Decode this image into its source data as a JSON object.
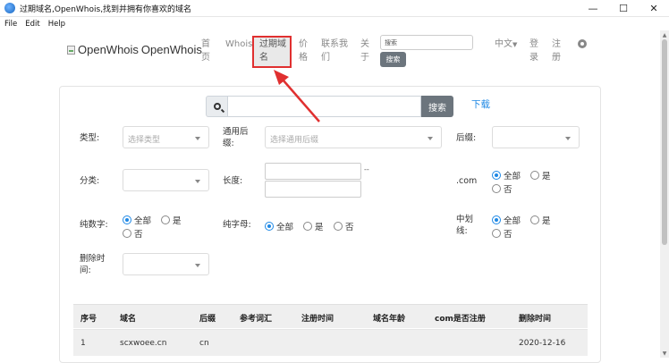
{
  "window": {
    "title": "过期域名,OpenWhois,找到并拥有你喜欢的域名",
    "minimize": "—",
    "maximize": "☐",
    "close": "✕"
  },
  "menu": [
    "File",
    "Edit",
    "Help"
  ],
  "nav": {
    "logo_alt": "OpenWhois",
    "logo_text": "OpenWhois",
    "items": [
      {
        "label_1": "首",
        "label_2": "页"
      },
      {
        "label_1": "Whois",
        "label_2": ""
      },
      {
        "label_1": "过期域",
        "label_2": "名"
      },
      {
        "label_1": "价",
        "label_2": "格"
      },
      {
        "label_1": "联系我",
        "label_2": "们"
      },
      {
        "label_1": "关",
        "label_2": "于"
      }
    ],
    "search_placeholder": "搜索",
    "search_button": "搜索",
    "language": "中文",
    "login_1": "登",
    "login_2": "录",
    "register_1": "注",
    "register_2": "册",
    "github_icon": "github-icon"
  },
  "search": {
    "button": "搜索",
    "download": "下载"
  },
  "filters": {
    "type_label": "类型:",
    "type_placeholder": "选择类型",
    "suffix_label_1": "通用后",
    "suffix_label_2": "缀:",
    "suffix_placeholder": "选择通用后缀",
    "suffix2_label": "后缀:",
    "category_label": "分类:",
    "length_label": "长度:",
    "length_dash": "--",
    "com_label": ".com",
    "digits_label": "纯数字:",
    "letters_label": "纯字母:",
    "hyphen_label_1": "中划",
    "hyphen_label_2": "线:",
    "delete_time_label_1": "删除时",
    "delete_time_label_2": "间:",
    "opt_all": "全部",
    "opt_yes": "是",
    "opt_no": "否"
  },
  "table": {
    "headers": [
      "序号",
      "域名",
      "后缀",
      "参考词汇",
      "注册时间",
      "域名年龄",
      "com是否注册",
      "删除时间"
    ],
    "rows": [
      {
        "index": "1",
        "domain": "scxwoee.cn",
        "suffix": "cn",
        "words": "",
        "reg_time": "",
        "age": "",
        "com_reg": "",
        "delete_time": "2020-12-16"
      }
    ]
  },
  "colors": {
    "accent": "#1e88e5",
    "highlight": "#e03030",
    "button": "#6c757d"
  }
}
